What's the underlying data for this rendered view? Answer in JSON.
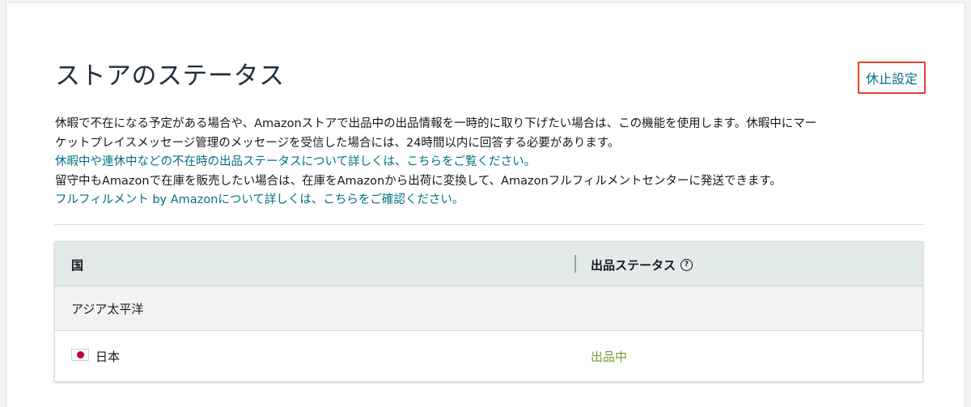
{
  "header": {
    "title": "ストアのステータス",
    "pause_button_label": "休止設定"
  },
  "description": {
    "line1": "休暇で不在になる予定がある場合や、Amazonストアで出品中の出品情報を一時的に取り下げたい場合は、この機能を使用します。休暇中にマー",
    "line2": "ケットプレイスメッセージ管理のメッセージを受信した場合には、24時間以内に回答する必要があります。",
    "link1": "休暇中や連休中などの不在時の出品ステータスについて詳しくは、こちらをご覧ください。",
    "line3": "留守中もAmazonで在庫を販売したい場合は、在庫をAmazonから出荷に変換して、Amazonフルフィルメントセンターに発送できます。",
    "link2": "フルフィルメント by Amazonについて詳しくは、こちらをご確認ください。"
  },
  "table": {
    "columns": {
      "country": "国",
      "status": "出品ステータス"
    },
    "help_icon": "question-circle-icon",
    "group_label": "アジア太平洋",
    "rows": [
      {
        "flag_icon": "japan-flag-icon",
        "country": "日本",
        "status": "出品中"
      }
    ]
  },
  "colors": {
    "link": "#007185",
    "highlight_border": "#e8412b",
    "status_active": "#7a9a2e",
    "header_bg": "#e3eaea"
  }
}
